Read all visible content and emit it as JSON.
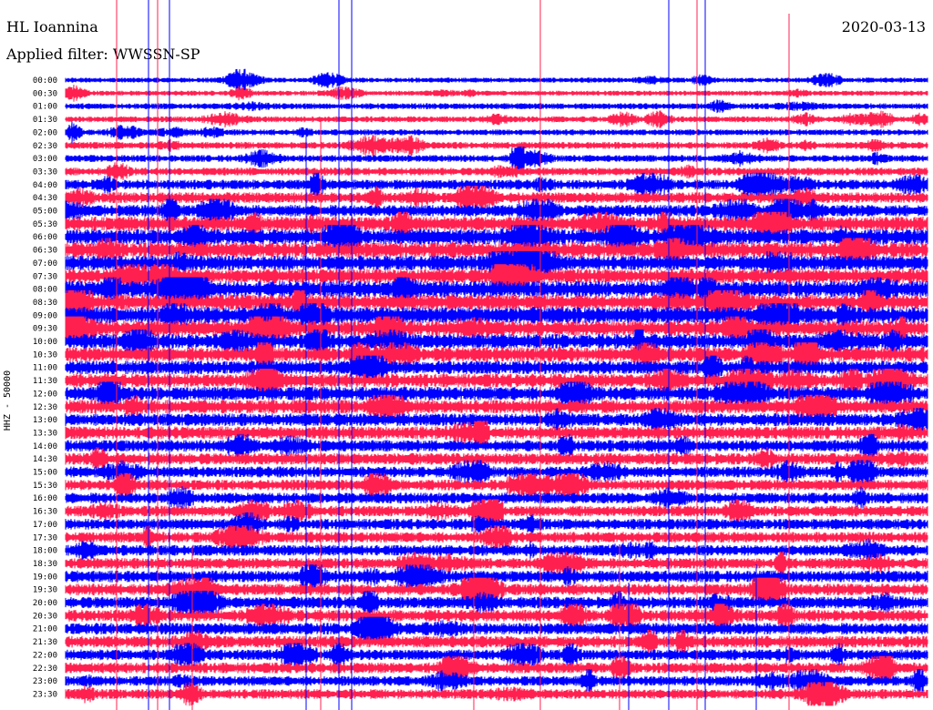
{
  "header": {
    "station": "HL Ioannina",
    "filter": "Applied filter: WWSSN-SP",
    "date": "2020-03-13"
  },
  "chart_data": {
    "type": "line",
    "ylabel": "HHZ - 50000",
    "row_labels": [
      "00:00",
      "00:30",
      "01:00",
      "01:30",
      "02:00",
      "02:30",
      "03:00",
      "03:30",
      "04:00",
      "04:30",
      "05:00",
      "05:30",
      "06:00",
      "06:30",
      "07:00",
      "07:30",
      "08:00",
      "08:30",
      "09:00",
      "09:30",
      "10:00",
      "10:30",
      "11:00",
      "11:30",
      "12:00",
      "12:30",
      "13:00",
      "13:30",
      "14:00",
      "14:30",
      "15:00",
      "15:30",
      "16:00",
      "16:30",
      "17:00",
      "17:30",
      "18:00",
      "18:30",
      "19:00",
      "19:30",
      "20:00",
      "20:30",
      "21:00",
      "21:30",
      "22:00",
      "22:30",
      "23:00",
      "23:30"
    ],
    "colors": [
      "#0000ff",
      "#ff2050"
    ],
    "row_amplitude": [
      0.25,
      0.25,
      0.3,
      0.3,
      0.3,
      0.35,
      0.35,
      0.4,
      0.5,
      0.55,
      0.6,
      0.75,
      0.8,
      0.8,
      0.75,
      0.75,
      0.85,
      0.8,
      0.85,
      0.8,
      0.75,
      0.75,
      0.7,
      0.7,
      0.7,
      0.7,
      0.65,
      0.65,
      0.6,
      0.6,
      0.55,
      0.55,
      0.55,
      0.55,
      0.55,
      0.55,
      0.55,
      0.55,
      0.6,
      0.6,
      0.6,
      0.6,
      0.6,
      0.6,
      0.55,
      0.55,
      0.5,
      0.5
    ]
  }
}
